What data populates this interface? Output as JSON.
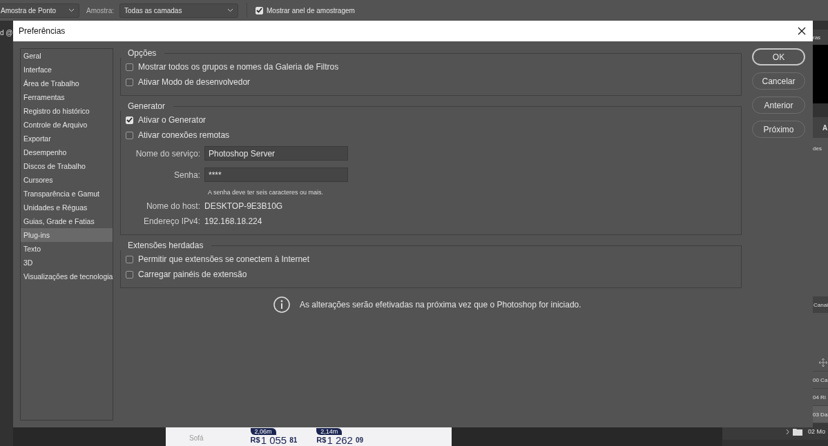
{
  "toolbar": {
    "sample_size": "Amostra de Ponto",
    "sample_label": "Amostra:",
    "sample_value": "Todas as camadas",
    "ring": {
      "label": "Mostrar anel de amostragem",
      "checked": true
    }
  },
  "background": {
    "doc_tab": "d @",
    "panel_tab": "ras",
    "panel_tabs": [
      "A"
    ],
    "panel_label": "des",
    "channels_tab": "Canai",
    "layers": [
      {
        "label": "00 Ca",
        "selected": false
      },
      {
        "label": "04 Ri",
        "selected": false
      },
      {
        "label": "03 Da",
        "selected": true
      },
      {
        "label": "02 Mo",
        "selected": false
      }
    ],
    "ad": {
      "product": "Sofá",
      "offers": [
        {
          "size": "2,06m",
          "currency": "R$",
          "price": "1 055",
          "cents": "81"
        },
        {
          "size": "2,14m",
          "currency": "R$",
          "price": "1 262",
          "cents": "09"
        }
      ]
    }
  },
  "dialog": {
    "title": "Preferências",
    "sidebar": {
      "items": [
        {
          "label": "Geral",
          "selected": false
        },
        {
          "label": "Interface",
          "selected": false
        },
        {
          "label": "Área de Trabalho",
          "selected": false
        },
        {
          "label": "Ferramentas",
          "selected": false
        },
        {
          "label": "Registro do histórico",
          "selected": false
        },
        {
          "label": "Controle de Arquivo",
          "selected": false
        },
        {
          "label": "Exportar",
          "selected": false
        },
        {
          "label": "Desempenho",
          "selected": false
        },
        {
          "label": "Discos de Trabalho",
          "selected": false
        },
        {
          "label": "Cursores",
          "selected": false
        },
        {
          "label": "Transparência e Gamut",
          "selected": false
        },
        {
          "label": "Unidades e Réguas",
          "selected": false
        },
        {
          "label": "Guias, Grade e Fatias",
          "selected": false
        },
        {
          "label": "Plug-ins",
          "selected": true
        },
        {
          "label": "Texto",
          "selected": false
        },
        {
          "label": "3D",
          "selected": false
        },
        {
          "label": "Visualizações de tecnologia",
          "selected": false
        }
      ]
    },
    "sections": [
      {
        "title": "Opções",
        "items": [
          {
            "kind": "checkbox",
            "label": "Mostrar todos os grupos e nomes da Galeria de Filtros",
            "checked": false
          },
          {
            "kind": "checkbox",
            "label": "Ativar Modo de desenvolvedor",
            "checked": false
          }
        ]
      },
      {
        "title": "Generator",
        "items": [
          {
            "kind": "checkbox",
            "label": "Ativar o Generator",
            "checked": true
          },
          {
            "kind": "checkbox",
            "label": "Ativar conexões remotas",
            "checked": false
          },
          {
            "kind": "field",
            "label": "Nome do serviço:",
            "value": "Photoshop Server"
          },
          {
            "kind": "field",
            "label": "Senha:",
            "value": "****"
          },
          {
            "kind": "hint",
            "text": "A senha deve ter seis caracteres ou mais."
          },
          {
            "kind": "info",
            "label": "Nome do host:",
            "value": "DESKTOP-9E3B10G"
          },
          {
            "kind": "info",
            "label": "Endereço IPv4:",
            "value": "192.168.18.224"
          }
        ]
      },
      {
        "title": "Extensões herdadas",
        "items": [
          {
            "kind": "checkbox",
            "label": "Permitir que extensões se conectem à Internet",
            "checked": false
          },
          {
            "kind": "checkbox",
            "label": "Carregar painéis de extensão",
            "checked": false
          }
        ]
      }
    ],
    "notice": "As alterações serão efetivadas na próxima vez que o Photoshop for iniciado.",
    "buttons": [
      {
        "label": "OK",
        "default": true
      },
      {
        "label": "Cancelar",
        "default": false
      },
      {
        "label": "Anterior",
        "default": false
      },
      {
        "label": "Próximo",
        "default": false
      }
    ]
  }
}
